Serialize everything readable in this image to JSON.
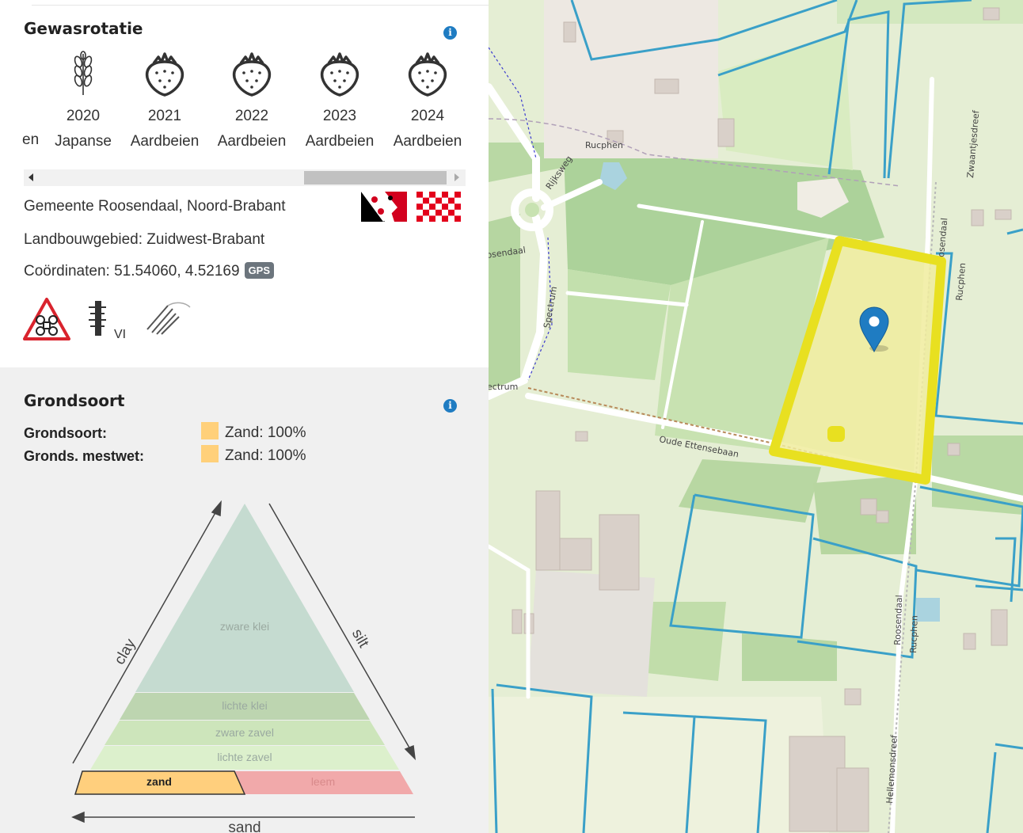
{
  "crop_rotation": {
    "title": "Gewasrotatie",
    "info_icon": "i",
    "partial_crop": "en",
    "years": [
      {
        "year": "2020",
        "crop": "Japanse",
        "icon": "wheat-icon"
      },
      {
        "year": "2021",
        "crop": "Aardbeien",
        "icon": "strawberry-icon"
      },
      {
        "year": "2022",
        "crop": "Aardbeien",
        "icon": "strawberry-icon"
      },
      {
        "year": "2023",
        "crop": "Aardbeien",
        "icon": "strawberry-icon"
      },
      {
        "year": "2024",
        "crop": "Aardbeien",
        "icon": "strawberry-icon"
      }
    ],
    "scroll_position": 1
  },
  "location": {
    "municipality": "Gemeente Roosendaal, Noord-Brabant",
    "agricultural_area": "Landbouwgebied: Zuidwest-Brabant",
    "coordinates": "Coördinaten: 51.54060, 4.52169",
    "gps_badge": "GPS",
    "groundwater_class": "VI"
  },
  "soil": {
    "title": "Grondsoort",
    "info_icon": "i",
    "rows": [
      {
        "label": "Grondsoort:",
        "value": "Zand: 100%",
        "color": "#ffd07a"
      },
      {
        "label": "Gronds. mestwet:",
        "value": "Zand: 100%",
        "color": "#ffd07a"
      }
    ],
    "triangle": {
      "zones": [
        "zware klei",
        "lichte klei",
        "zware zavel",
        "lichte zavel",
        "zand",
        "leem"
      ],
      "active_zone": "zand",
      "axis_left": "clay",
      "axis_right": "silt",
      "axis_bottom": "sand"
    }
  },
  "map": {
    "streets": [
      "Rucphen",
      "Rijksweg",
      "osendaal",
      "Spectrum",
      "ectrum",
      "Oude Ettensebaan",
      "Zwaantjesdreef",
      "osendaal",
      "Rucphen",
      "Roosendaal",
      "Rucphen",
      "Hellemonsdreef"
    ],
    "highlight_color": "#e8e020",
    "parcel_color": "#3aa0c8",
    "marker_color": "#1f7cc2"
  }
}
